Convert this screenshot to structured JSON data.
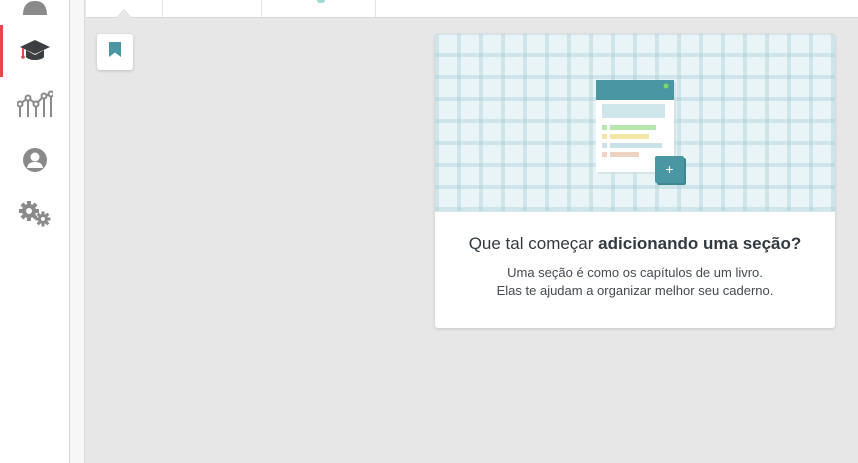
{
  "sidebar": {
    "items": [
      {
        "name": "people-icon",
        "active": false
      },
      {
        "name": "graduation-cap-icon",
        "active": true
      },
      {
        "name": "line-chart-icon",
        "active": false
      },
      {
        "name": "user-profile-icon",
        "active": false
      },
      {
        "name": "settings-gears-icon",
        "active": false
      }
    ]
  },
  "colors": {
    "accent": "#e5484d",
    "teal": "#4a97a3",
    "icon_gray": "#8a8a8a"
  },
  "empty_state": {
    "title_prefix": "Que tal começar",
    "title_bold": "adicionando uma seção?",
    "description_line1": "Uma seção é como os capítulos de um livro.",
    "description_line2": "Elas te ajudam a organizar melhor seu caderno.",
    "add_symbol": "+"
  }
}
